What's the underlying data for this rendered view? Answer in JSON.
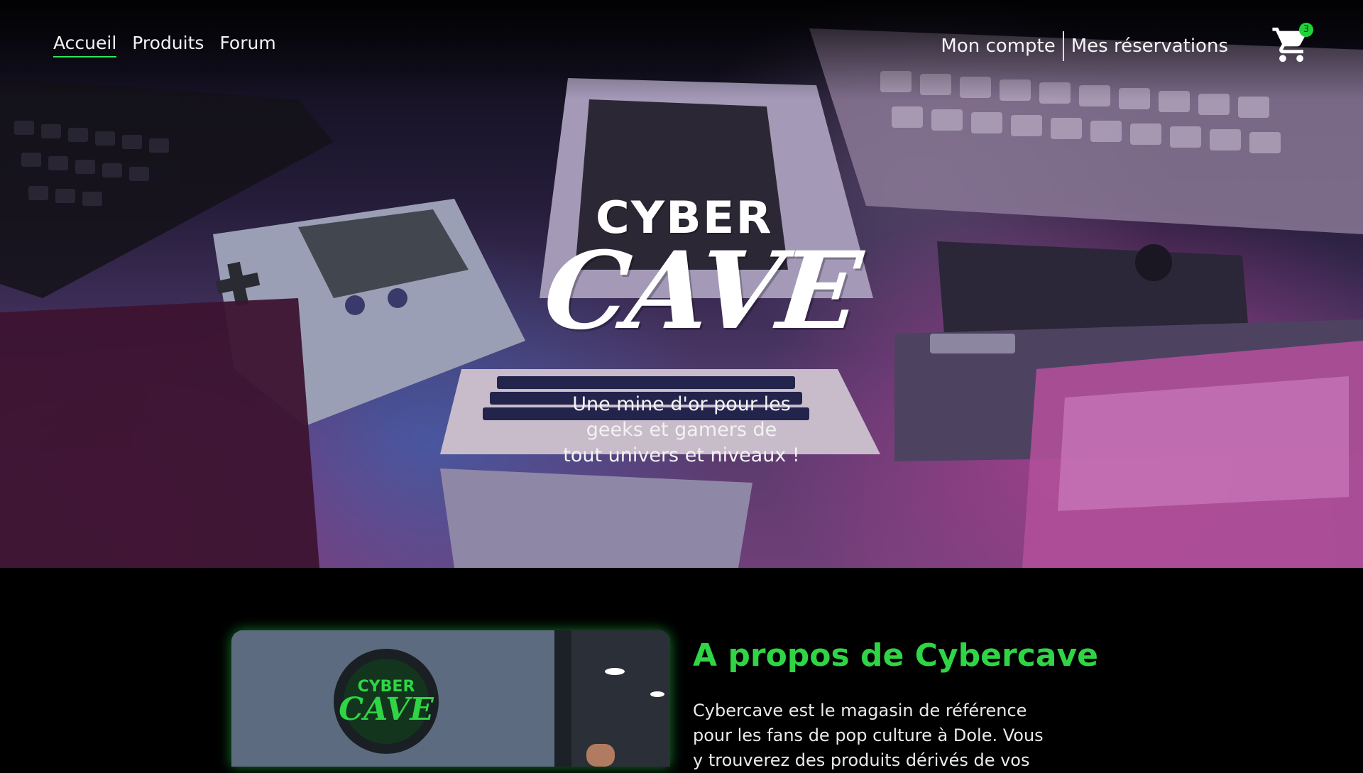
{
  "nav": {
    "left": [
      {
        "label": "Accueil",
        "active": true
      },
      {
        "label": "Produits",
        "active": false
      },
      {
        "label": "Forum",
        "active": false
      }
    ],
    "account_label": "Mon compte",
    "reservations_label": "Mes réservations",
    "cart": {
      "icon": "cart-icon",
      "count": "3"
    }
  },
  "hero": {
    "logo_top": "CYBER",
    "logo_bottom": "CAVE",
    "tagline_lines": [
      "Une mine d'or pour les",
      "geeks et gamers de",
      "tout univers et niveaux !"
    ]
  },
  "about": {
    "title": "A propos de Cybercave",
    "text_lines": [
      "Cybercave est le magasin de référence",
      "pour les fans de pop culture à Dole. Vous",
      "y trouverez des produits dérivés de vos"
    ],
    "image_sign_top": "CYBER",
    "image_sign_bottom": "CAVE"
  },
  "colors": {
    "accent_green": "#2fd545",
    "background": "#000000",
    "text": "#ffffff"
  }
}
